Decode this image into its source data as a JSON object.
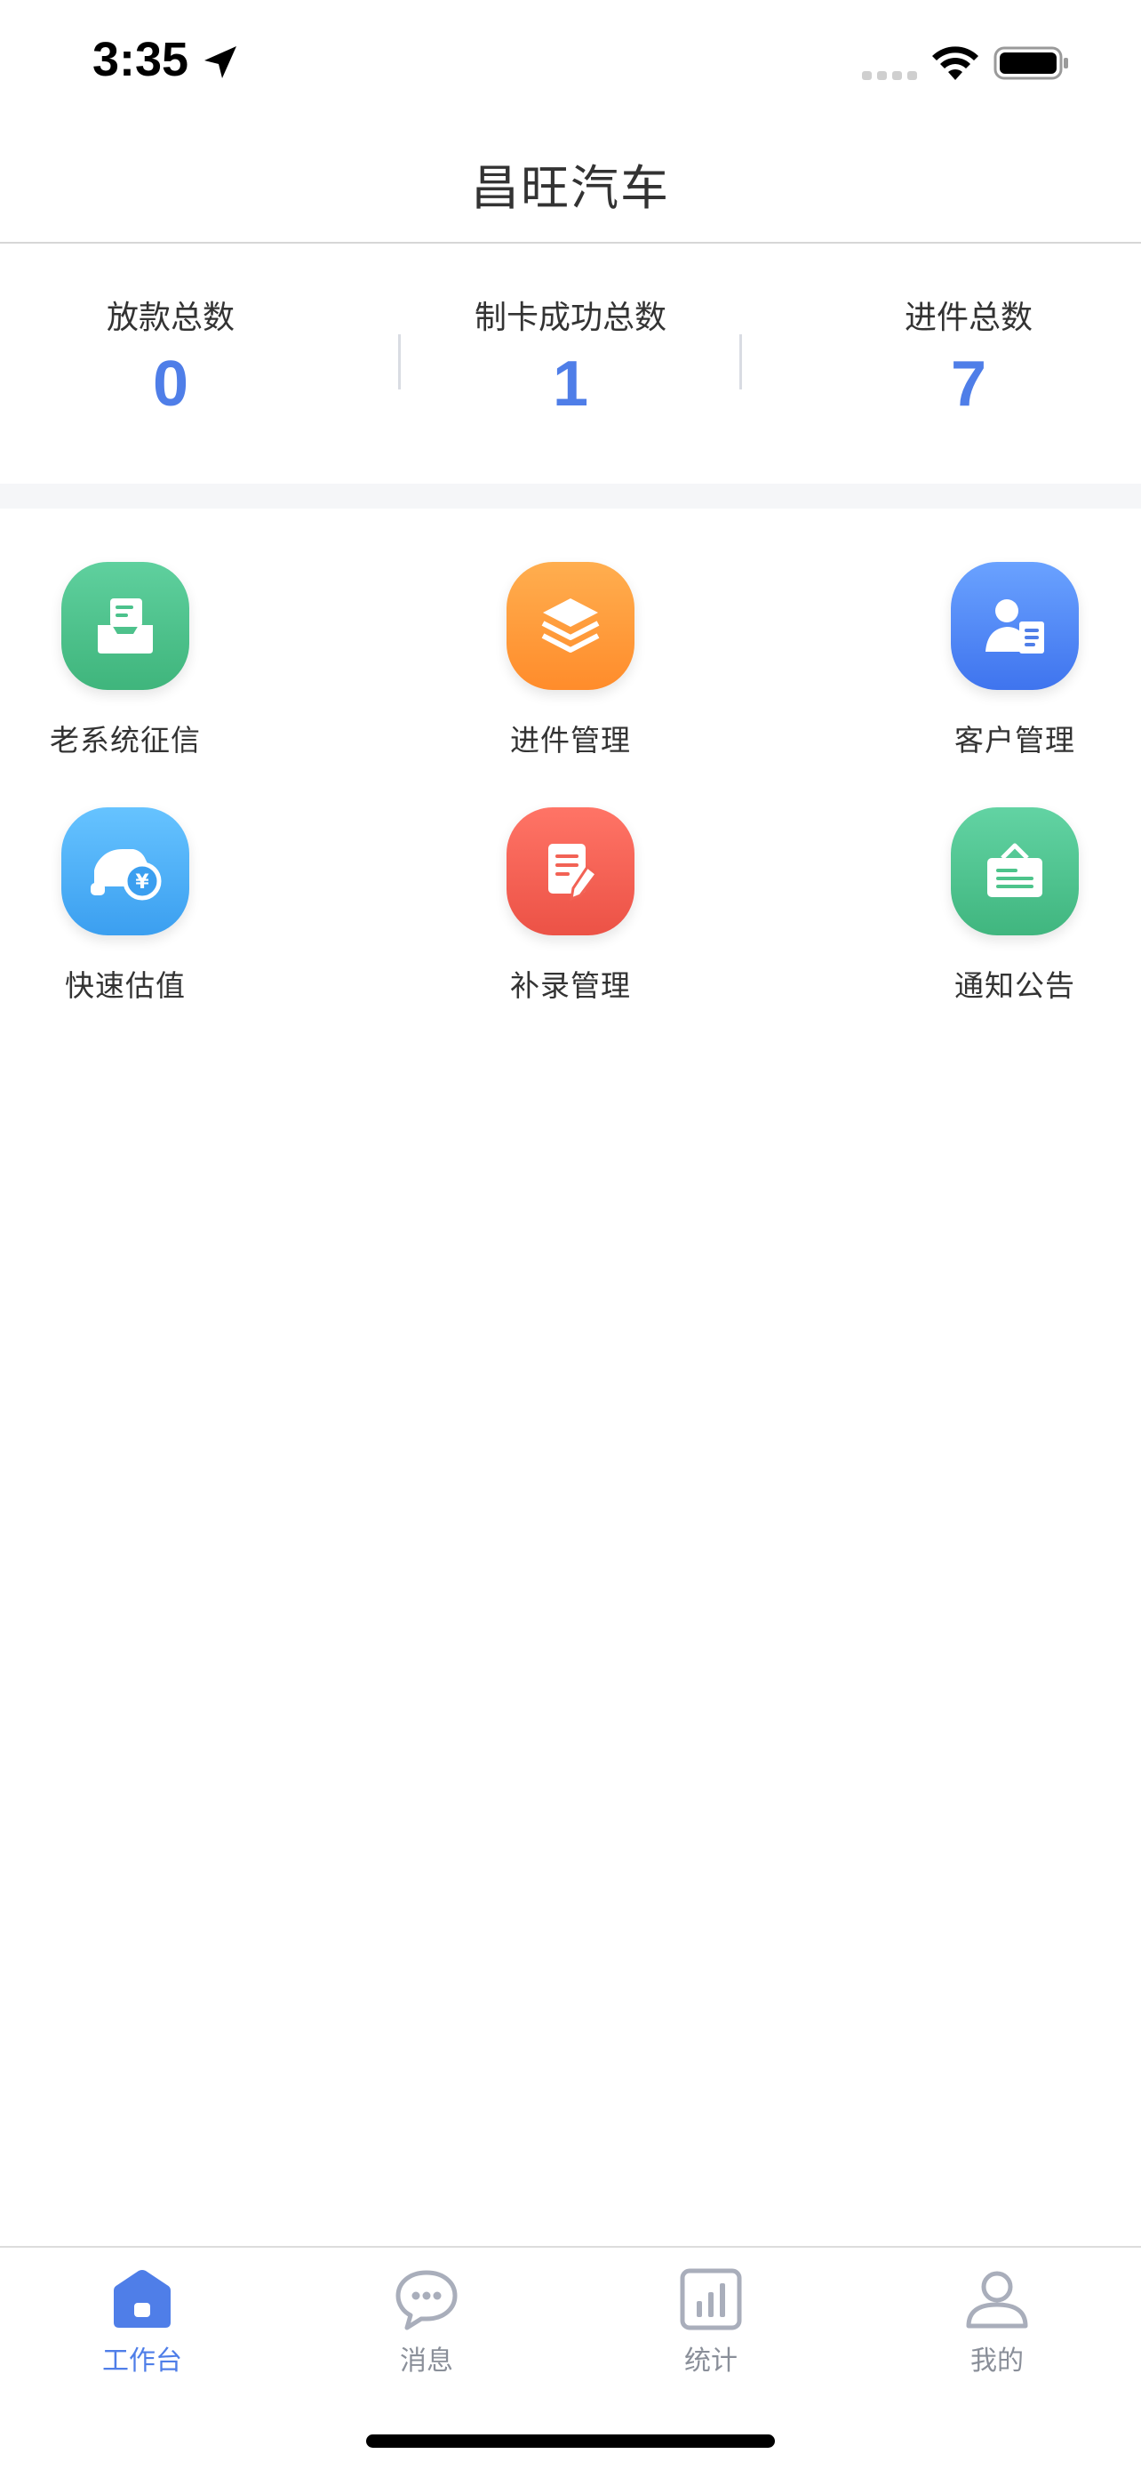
{
  "status_bar": {
    "time": "3:35",
    "icons": [
      "location-arrow-icon",
      "cellular-signal-icon",
      "wifi-icon",
      "battery-icon"
    ]
  },
  "header": {
    "title": "昌旺汽车"
  },
  "stats": [
    {
      "label": "放款总数",
      "value": "0"
    },
    {
      "label": "制卡成功总数",
      "value": "1"
    },
    {
      "label": "进件总数",
      "value": "7"
    }
  ],
  "grid": [
    {
      "label": "老系统征信",
      "icon": "inbox-card-icon",
      "color": "#4cc28c"
    },
    {
      "label": "进件管理",
      "icon": "layers-icon",
      "color": "#ff9b3a"
    },
    {
      "label": "客户管理",
      "icon": "customer-profile-icon",
      "color": "#5289f5"
    },
    {
      "label": "快速估值",
      "icon": "car-valuation-icon",
      "color": "#4cb0f7"
    },
    {
      "label": "补录管理",
      "icon": "document-edit-icon",
      "color": "#f26255"
    },
    {
      "label": "通知公告",
      "icon": "notice-board-icon",
      "color": "#4dc48b"
    }
  ],
  "tabs": [
    {
      "label": "工作台",
      "icon": "home-icon",
      "active": true
    },
    {
      "label": "消息",
      "icon": "message-bubble-icon",
      "active": false
    },
    {
      "label": "统计",
      "icon": "bar-chart-icon",
      "active": false
    },
    {
      "label": "我的",
      "icon": "user-icon",
      "active": false
    }
  ],
  "colors": {
    "accent": "#4f7ee8",
    "tab_inactive": "#8a8f99"
  }
}
